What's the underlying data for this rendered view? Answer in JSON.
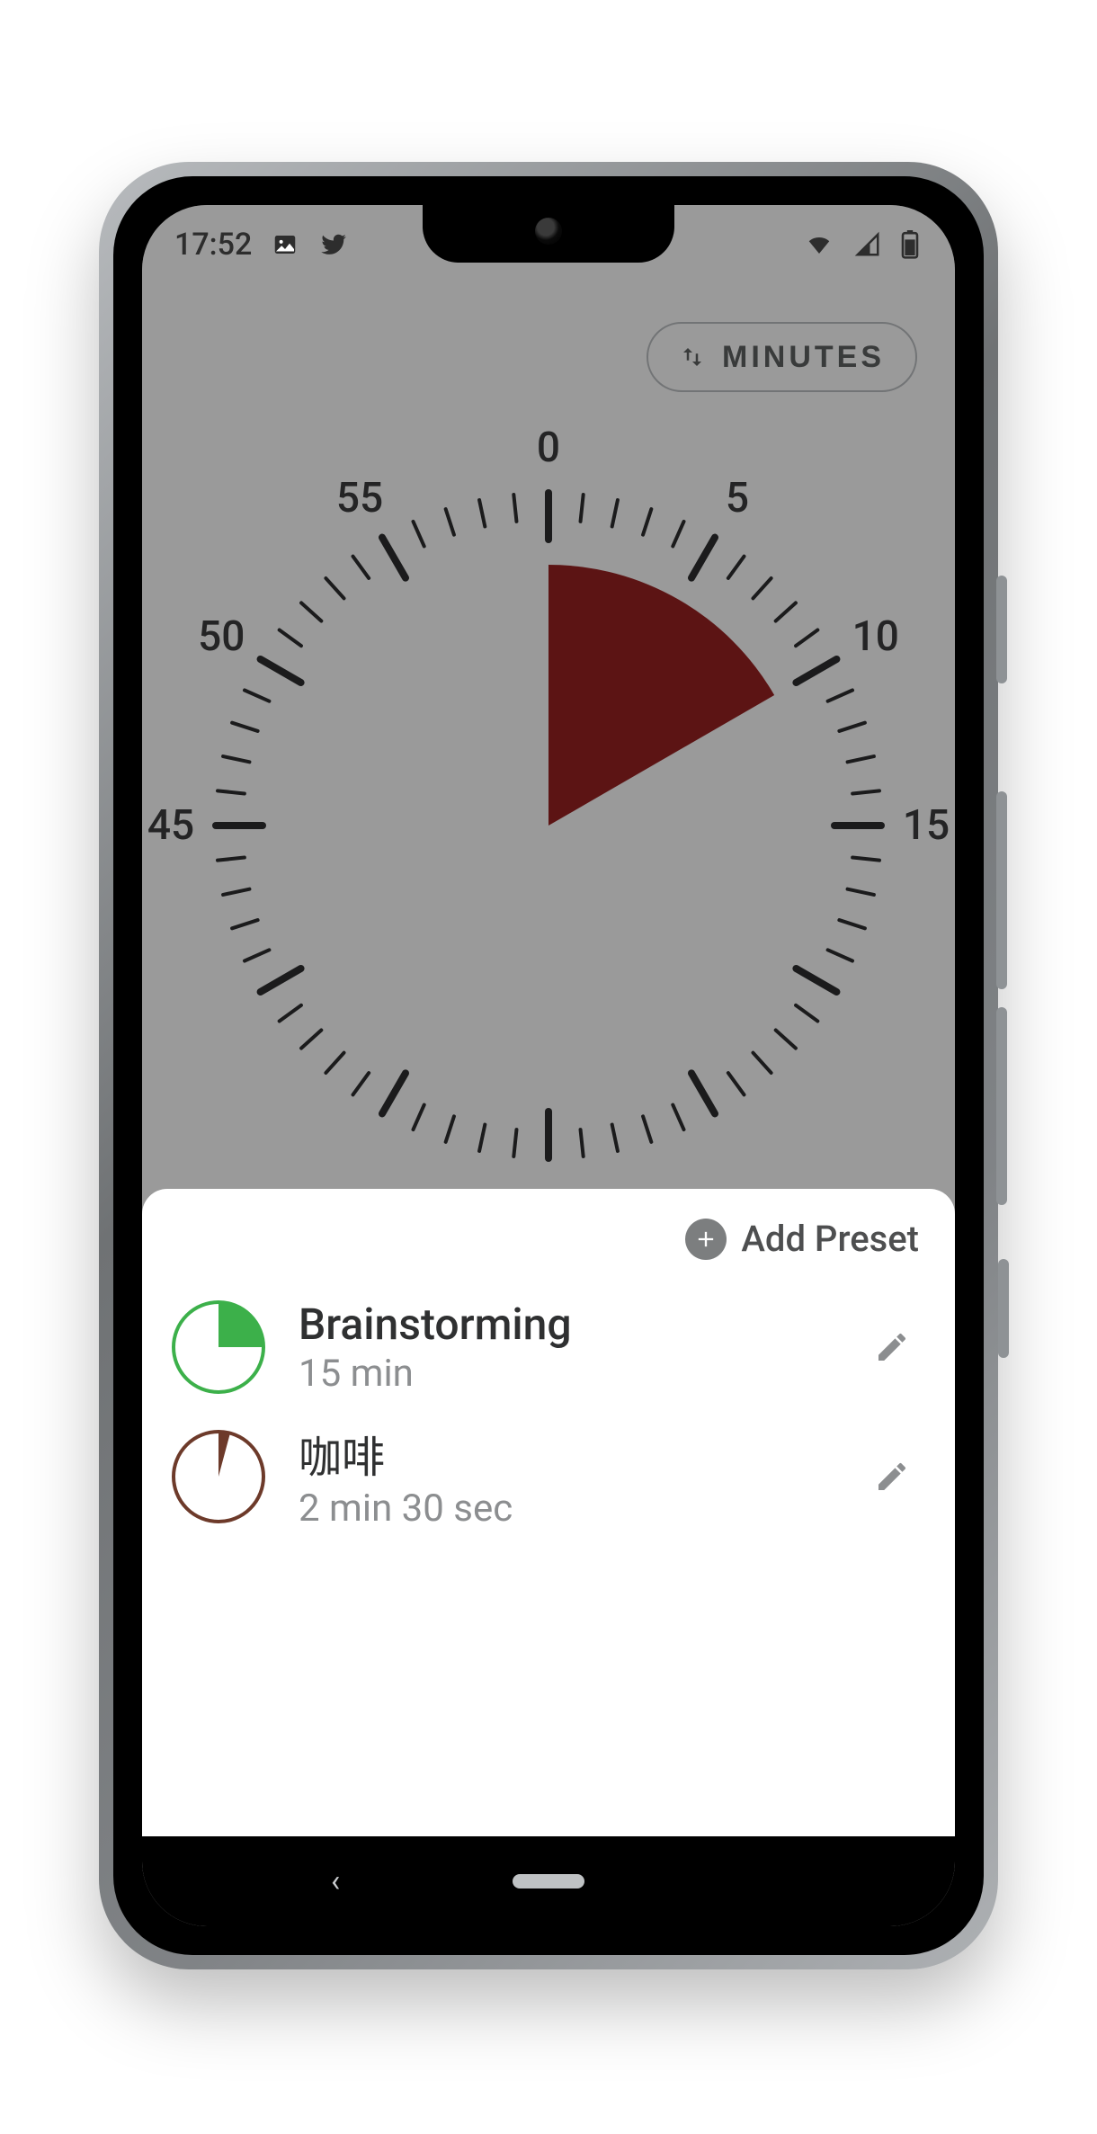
{
  "status": {
    "time": "17:52",
    "icons": {
      "image": "image-icon",
      "twitter": "twitter-icon",
      "wifi": "wifi-icon",
      "cell": "cell-signal-icon",
      "battery": "battery-icon"
    }
  },
  "chip": {
    "label": "MINUTES",
    "icon": "swap-vertical-icon"
  },
  "dial": {
    "ticks": [
      "0",
      "5",
      "10",
      "15",
      "45",
      "50",
      "55"
    ],
    "value_minutes": 10,
    "max_minutes": 60,
    "unit": "minutes",
    "wedge_color": "#952121"
  },
  "sheet": {
    "add_label": "Add Preset",
    "presets": [
      {
        "title": "Brainstorming",
        "subtitle": "15 min",
        "minutes": 15,
        "fraction": 0.25,
        "color": "#3cb04a"
      },
      {
        "title": "咖啡",
        "subtitle": "2 min 30 sec",
        "minutes": 2.5,
        "fraction": 0.0417,
        "color": "#6d3a2a"
      }
    ]
  },
  "navbar": {
    "back": "‹"
  }
}
